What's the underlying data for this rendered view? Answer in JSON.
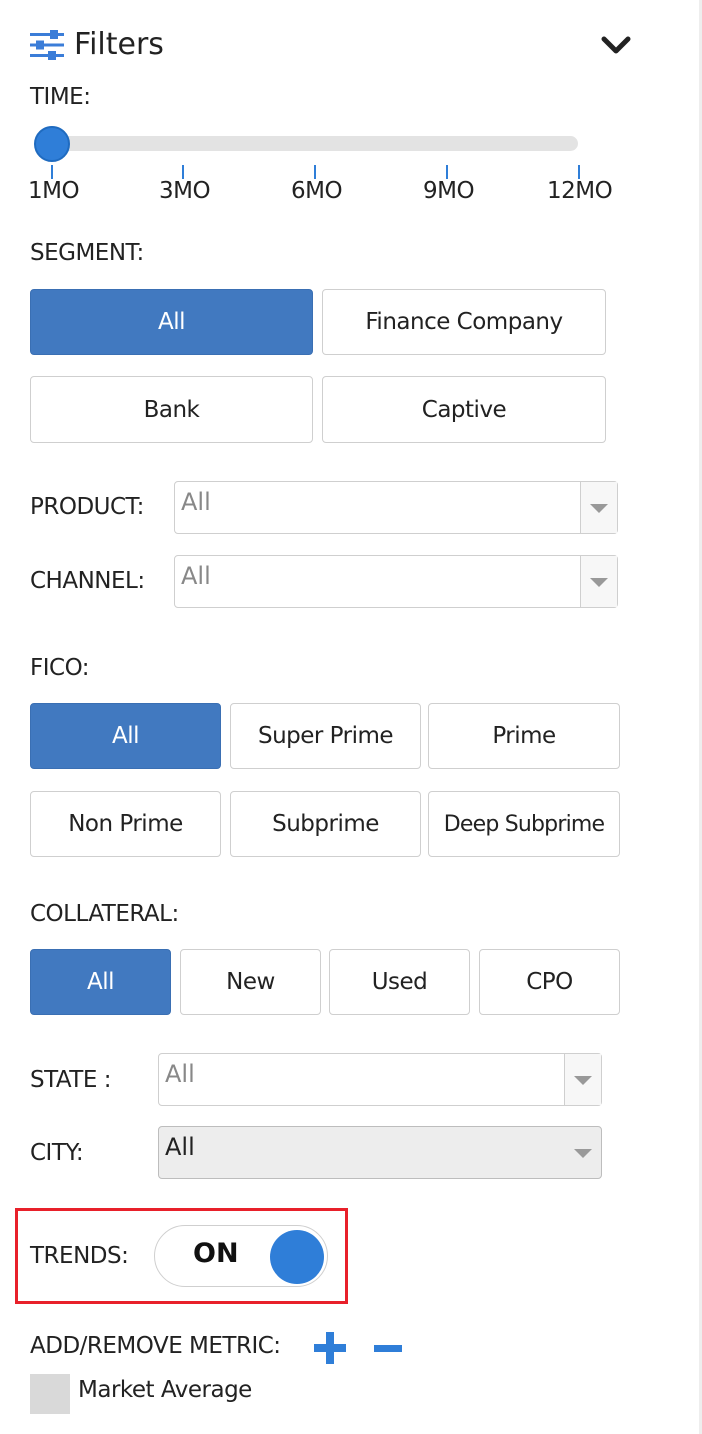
{
  "header": {
    "title": "Filters",
    "icon": "sliders-icon",
    "collapse_icon": "chevron-down-icon"
  },
  "time": {
    "label": "TIME:",
    "ticks": [
      "1MO",
      "3MO",
      "6MO",
      "9MO",
      "12MO"
    ],
    "selected": "1MO"
  },
  "segment": {
    "label": "SEGMENT:",
    "options": [
      "All",
      "Finance Company",
      "Bank",
      "Captive"
    ],
    "selected": "All"
  },
  "product": {
    "label": "PRODUCT:",
    "value": "All"
  },
  "channel": {
    "label": "CHANNEL:",
    "value": "All"
  },
  "fico": {
    "label": "FICO:",
    "options": [
      "All",
      "Super Prime",
      "Prime",
      "Non Prime",
      "Subprime",
      "Deep Subprime"
    ],
    "selected": "All"
  },
  "collateral": {
    "label": "COLLATERAL:",
    "options": [
      "All",
      "New",
      "Used",
      "CPO"
    ],
    "selected": "All"
  },
  "state": {
    "label": "STATE :",
    "value": "All"
  },
  "city": {
    "label": "CITY:",
    "value": "All"
  },
  "trends": {
    "label": "TRENDS:",
    "state": "ON",
    "highlight_color": "#e8202a"
  },
  "metric": {
    "label": "ADD/REMOVE METRIC:",
    "add_icon": "plus-icon",
    "remove_icon": "minus-icon",
    "legend": [
      {
        "label": "Market Average",
        "color": "#d9d9d9"
      }
    ]
  },
  "colors": {
    "accent": "#2f7ed8",
    "active_button": "#4179c0"
  }
}
